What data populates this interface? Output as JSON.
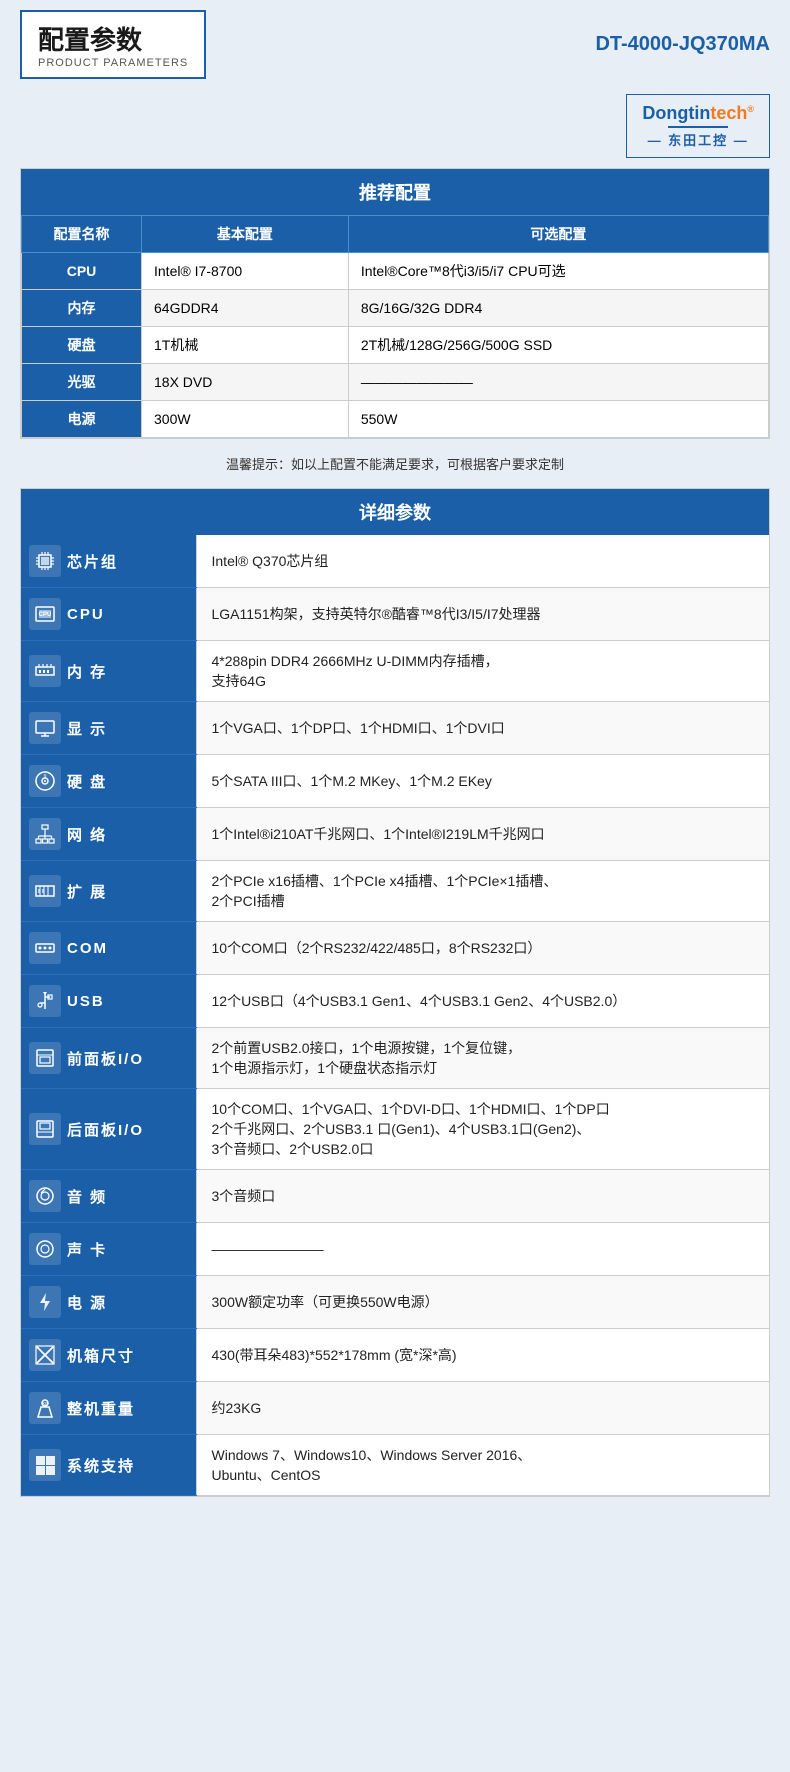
{
  "header": {
    "title_zh": "配置参数",
    "title_en": "PRODUCT PARAMETERS",
    "model": "DT-4000-JQ370MA"
  },
  "logo": {
    "brand": "Dongtintech",
    "brand_cn": "东田工控",
    "reg_symbol": "®"
  },
  "recommended": {
    "section_title": "推荐配置",
    "columns": [
      "配置名称",
      "基本配置",
      "可选配置"
    ],
    "rows": [
      {
        "name": "CPU",
        "basic": "Intel® I7-8700",
        "optional": "Intel®Core™8代i3/i5/i7 CPU可选"
      },
      {
        "name": "内存",
        "basic": "64GDDR4",
        "optional": "8G/16G/32G DDR4"
      },
      {
        "name": "硬盘",
        "basic": "1T机械",
        "optional": "2T机械/128G/256G/500G SSD"
      },
      {
        "name": "光驱",
        "basic": "18X DVD",
        "optional": "————————"
      },
      {
        "name": "电源",
        "basic": "300W",
        "optional": "550W"
      }
    ]
  },
  "notice": {
    "prefix": "温馨提示：",
    "text": "如以上配置不能满足要求，可根据客户要求定制"
  },
  "detail": {
    "section_title": "详细参数",
    "rows": [
      {
        "icon": "chip",
        "label": "芯片组",
        "value": "Intel® Q370芯片组"
      },
      {
        "icon": "cpu",
        "label": "CPU",
        "value": "LGA1151构架，支持英特尔®酷睿™8代I3/I5/I7处理器"
      },
      {
        "icon": "ram",
        "label": "内 存",
        "value": "4*288pin DDR4 2666MHz U-DIMM内存插槽，\n支持64G"
      },
      {
        "icon": "display",
        "label": "显 示",
        "value": "1个VGA口、1个DP口、1个HDMI口、1个DVI口"
      },
      {
        "icon": "hdd",
        "label": "硬 盘",
        "value": "5个SATA III口、1个M.2 MKey、1个M.2 EKey"
      },
      {
        "icon": "net",
        "label": "网 络",
        "value": "1个Intel®i210AT千兆网口、1个Intel®I219LM千兆网口"
      },
      {
        "icon": "expand",
        "label": "扩 展",
        "value": "2个PCIe x16插槽、1个PCIe x4插槽、1个PCIe×1插槽、\n2个PCI插槽"
      },
      {
        "icon": "com",
        "label": "COM",
        "value": "10个COM口（2个RS232/422/485口，8个RS232口）"
      },
      {
        "icon": "usb",
        "label": "USB",
        "value": "12个USB口（4个USB3.1 Gen1、4个USB3.1 Gen2、4个USB2.0）"
      },
      {
        "icon": "frontio",
        "label": "前面板I/O",
        "value": "2个前置USB2.0接口，1个电源按键，1个复位键，\n1个电源指示灯，1个硬盘状态指示灯"
      },
      {
        "icon": "reario",
        "label": "后面板I/O",
        "value": "10个COM口、1个VGA口、1个DVI-D口、1个HDMI口、1个DP口\n2个千兆网口、2个USB3.1 口(Gen1)、4个USB3.1口(Gen2)、\n3个音频口、2个USB2.0口"
      },
      {
        "icon": "audio",
        "label": "音 频",
        "value": "3个音频口"
      },
      {
        "icon": "soundcard",
        "label": "声 卡",
        "value": "————————"
      },
      {
        "icon": "power",
        "label": "电 源",
        "value": "300W额定功率（可更换550W电源）"
      },
      {
        "icon": "chassis",
        "label": "机箱尺寸",
        "value": "430(带耳朵483)*552*178mm (宽*深*高)"
      },
      {
        "icon": "weight",
        "label": "整机重量",
        "value": "约23KG"
      },
      {
        "icon": "os",
        "label": "系统支持",
        "value": "Windows 7、Windows10、Windows Server 2016、\nUbuntu、CentOS"
      }
    ]
  }
}
